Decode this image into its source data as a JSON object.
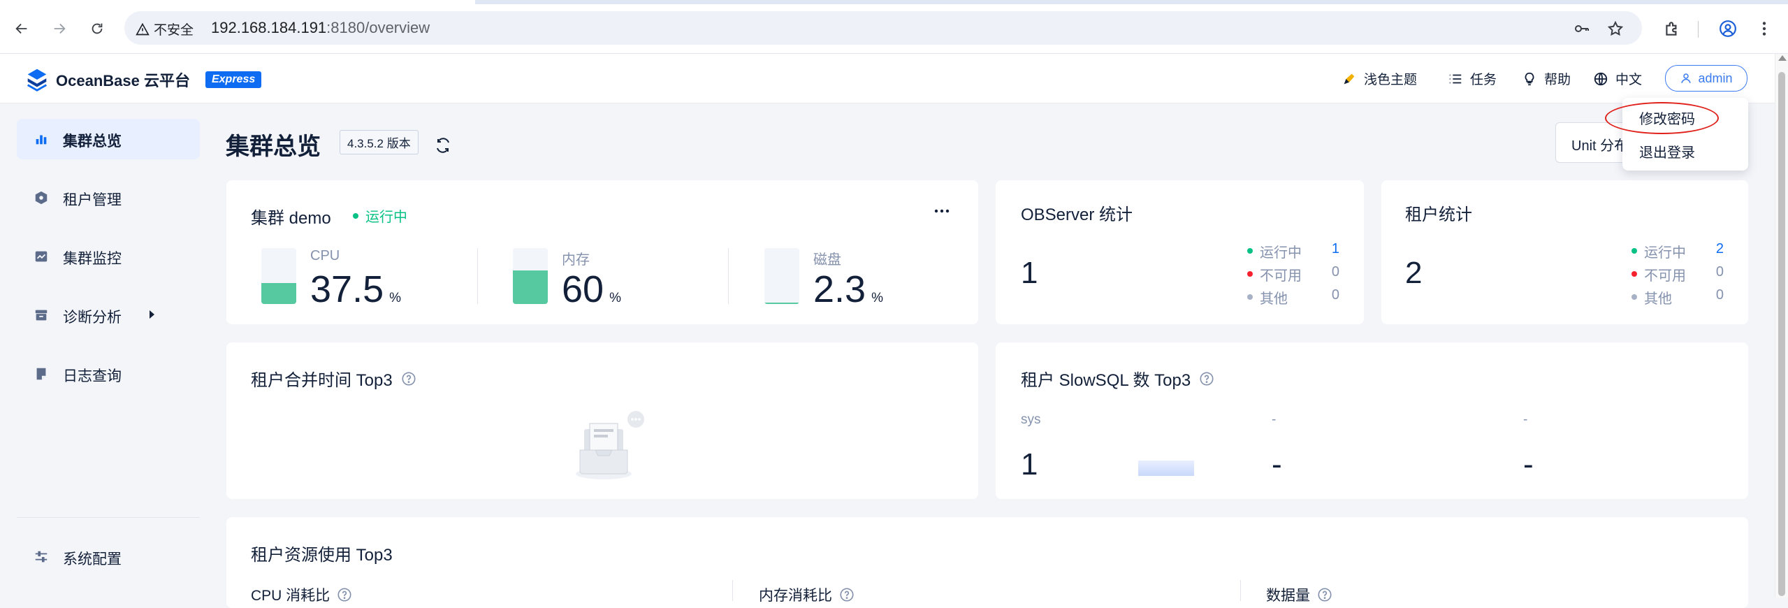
{
  "browser": {
    "security_label": "不安全",
    "url_host": "192.168.184.191",
    "url_path": ":8180/overview"
  },
  "header": {
    "logo_text": "OceanBase 云平台",
    "badge": "Express",
    "theme_label": "浅色主题",
    "tasks_label": "任务",
    "help_label": "帮助",
    "lang_label": "中文",
    "user_label": "admin"
  },
  "user_menu": {
    "items": [
      "修改密码",
      "退出登录"
    ]
  },
  "sidebar": {
    "items": [
      {
        "label": "集群总览",
        "icon": "bar-chart-icon",
        "active": true
      },
      {
        "label": "租户管理",
        "icon": "tenant-hexagon-icon"
      },
      {
        "label": "集群监控",
        "icon": "monitor-chart-icon"
      },
      {
        "label": "诊断分析",
        "icon": "diagnosis-box-icon",
        "has_submenu": true
      },
      {
        "label": "日志查询",
        "icon": "log-file-icon"
      },
      {
        "label": "系统配置",
        "icon": "settings-sliders-icon"
      }
    ]
  },
  "page": {
    "title": "集群总览",
    "version": "4.3.5.2 版本",
    "unit_button": "Unit 分布"
  },
  "cluster_card": {
    "title": "集群 demo",
    "status": "运行中",
    "status_color": "#0ac185",
    "metrics": [
      {
        "label": "CPU",
        "value": "37.5",
        "unit": "%",
        "fill_fraction": 0.375
      },
      {
        "label": "内存",
        "value": "60",
        "unit": "%",
        "fill_fraction": 0.6
      },
      {
        "label": "磁盘",
        "value": "2.3",
        "unit": "%",
        "fill_fraction": 0.023
      }
    ]
  },
  "observer_card": {
    "title": "OBServer 统计",
    "total": "1",
    "rows": [
      {
        "label": "运行中",
        "value": "1",
        "color": "#0ac185",
        "value_color": "#0d6cf2"
      },
      {
        "label": "不可用",
        "value": "0",
        "color": "#f5222d"
      },
      {
        "label": "其他",
        "value": "0",
        "color": "#a7b1c5"
      }
    ]
  },
  "tenant_card": {
    "title": "租户统计",
    "total": "2",
    "rows": [
      {
        "label": "运行中",
        "value": "2",
        "color": "#0ac185",
        "value_color": "#0d6cf2"
      },
      {
        "label": "不可用",
        "value": "0",
        "color": "#f5222d"
      },
      {
        "label": "其他",
        "value": "0",
        "color": "#a7b1c5"
      }
    ]
  },
  "merge_card": {
    "title": "租户合并时间 Top3"
  },
  "slowsql_card": {
    "title": "租户 SlowSQL 数 Top3",
    "columns": [
      {
        "name": "sys",
        "value": "1"
      },
      {
        "name": "-",
        "value": "-"
      },
      {
        "name": "-",
        "value": "-"
      }
    ]
  },
  "resource_card": {
    "title": "租户资源使用 Top3",
    "columns": [
      "CPU 消耗比",
      "内存消耗比",
      "数据量"
    ]
  }
}
